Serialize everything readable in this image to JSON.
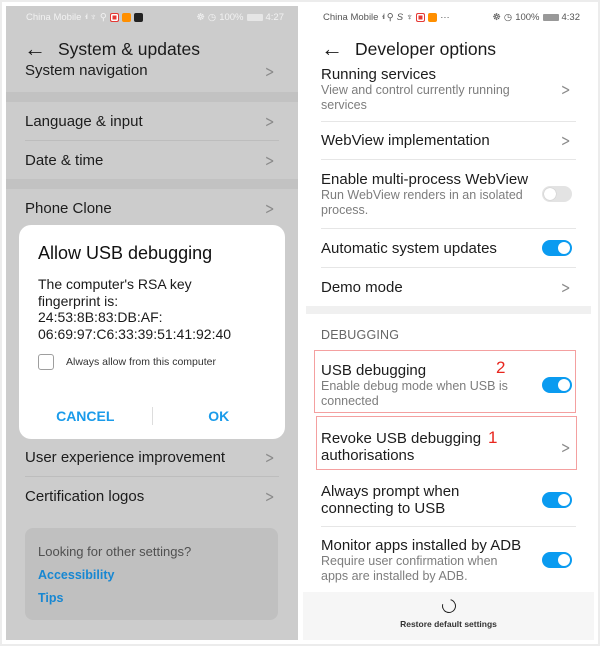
{
  "left_screen": {
    "status_bar": {
      "carrier": "China Mobile",
      "network": "4G",
      "battery": "100%",
      "time": "4:27"
    },
    "header": {
      "back_icon": "arrow-left-icon",
      "title": "System & updates"
    },
    "items": [
      {
        "label": "System navigation"
      },
      {
        "label": "Language & input"
      },
      {
        "label": "Date & time"
      },
      {
        "label": "Phone Clone"
      },
      {
        "label": "User experience improvement"
      },
      {
        "label": "Certification logos"
      }
    ],
    "dialog": {
      "title": "Allow USB debugging",
      "body_line1": "The computer's RSA key",
      "body_line2": "fingerprint is:",
      "fingerprint_line1": "24:53:8B:83:DB:AF:",
      "fingerprint_line2": "06:69:97:C6:33:39:51:41:92:40",
      "checkbox_label": "Always allow from this computer",
      "checkbox_checked": false,
      "cancel_label": "CANCEL",
      "ok_label": "OK"
    },
    "other_settings": {
      "title": "Looking for other settings?",
      "links": [
        "Accessibility",
        "Tips"
      ]
    }
  },
  "right_screen": {
    "status_bar": {
      "carrier": "China Mobile",
      "network": "4G",
      "battery": "100%",
      "time": "4:32"
    },
    "header": {
      "back_icon": "arrow-left-icon",
      "title": "Developer options"
    },
    "items_top": [
      {
        "label": "Running services",
        "sub": "View and control currently running services",
        "control": "chevron"
      },
      {
        "label": "WebView implementation",
        "control": "chevron"
      },
      {
        "label": "Enable multi-process WebView",
        "sub": "Run WebView renders in an isolated process.",
        "control": "toggle",
        "on": false
      },
      {
        "label": "Automatic system updates",
        "control": "toggle",
        "on": true
      },
      {
        "label": "Demo mode",
        "control": "chevron"
      }
    ],
    "section_header": "DEBUGGING",
    "items_debug": [
      {
        "label": "USB debugging",
        "sub": "Enable debug mode when USB is connected",
        "control": "toggle",
        "on": true
      },
      {
        "label": "Revoke USB debugging authorisations",
        "control": "chevron"
      },
      {
        "label": "Always prompt when connecting to USB",
        "control": "toggle",
        "on": true
      },
      {
        "label": "Monitor apps installed by ADB",
        "sub": "Require user confirmation when apps are installed by ADB.",
        "control": "toggle",
        "on": true
      }
    ],
    "annotations": {
      "step1": "1",
      "step2": "2"
    },
    "footer": {
      "icon": "restore-icon",
      "label": "Restore default settings"
    }
  },
  "colors": {
    "accent": "#0a9bf0",
    "dialog_button": "#1a9bea",
    "link": "#1787d2",
    "annotation": "#e8261e",
    "dim_overlay": "#cccccc"
  }
}
